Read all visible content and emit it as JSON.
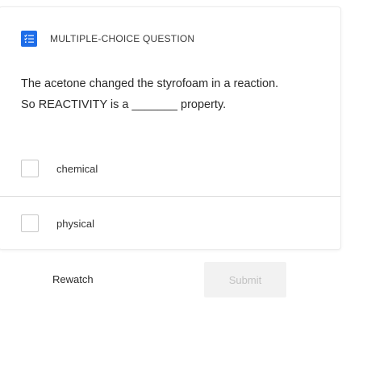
{
  "question": {
    "type_label": "MULTIPLE-CHOICE QUESTION",
    "type_icon": "checklist-icon",
    "text_line1": "The acetone changed the styrofoam in a reaction.",
    "text_line2": "So REACTIVITY is a _______ property."
  },
  "options": [
    {
      "label": "chemical",
      "checked": false
    },
    {
      "label": "physical",
      "checked": false
    }
  ],
  "actions": {
    "rewatch_label": "Rewatch",
    "submit_label": "Submit",
    "submit_enabled": false
  },
  "colors": {
    "accent": "#1e6de8",
    "submit_disabled_bg": "#f2f2f2",
    "submit_disabled_text": "#c2c2c2"
  }
}
